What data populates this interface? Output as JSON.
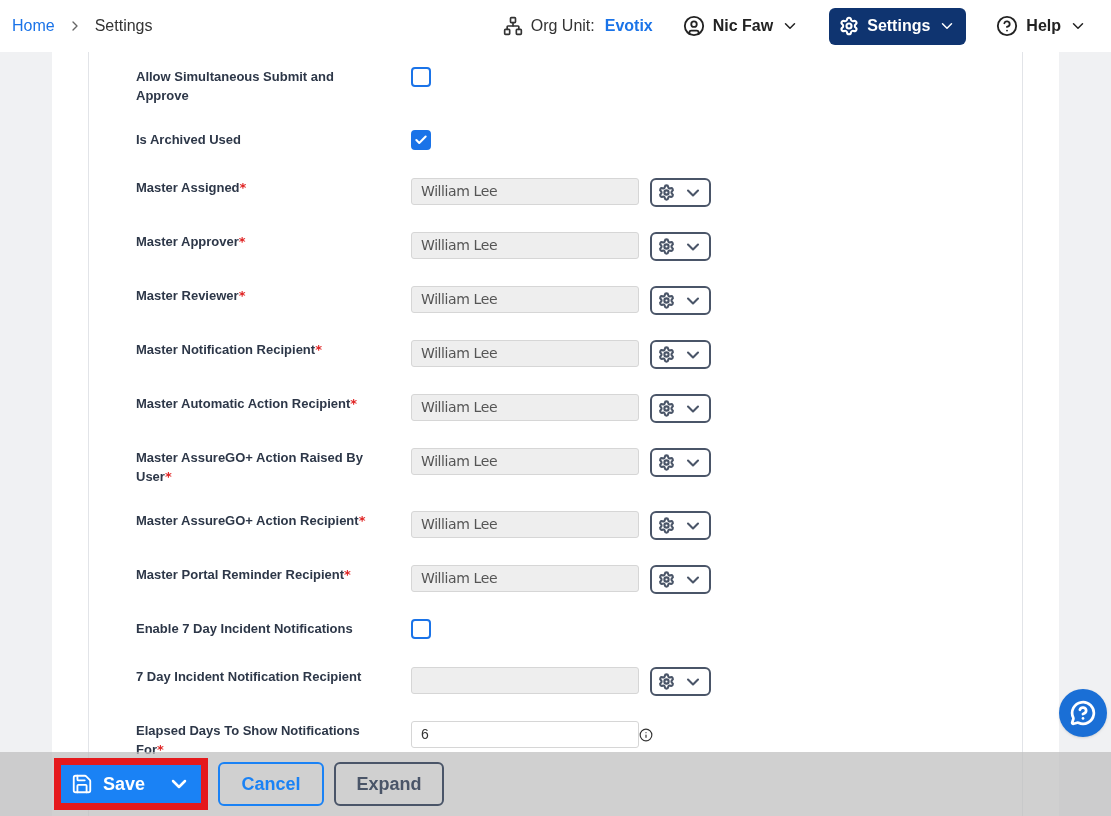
{
  "nav": {
    "breadcrumbs": [
      {
        "label": "Home",
        "link": true
      },
      {
        "label": "Settings",
        "link": false
      }
    ],
    "org_unit_label": "Org Unit:",
    "org_unit": "Evotix",
    "user": "Nic Faw",
    "settings": "Settings",
    "help": "Help"
  },
  "rows": [
    {
      "kind": "checkbox",
      "label": "Allow Simultaneous Submit and Approve",
      "checked": false
    },
    {
      "kind": "checkbox",
      "label": "Is Archived Used",
      "checked": true
    },
    {
      "kind": "picker",
      "label": "Master Assigned",
      "required_mark": "*",
      "value": "William Lee",
      "disabled": true
    },
    {
      "kind": "picker",
      "label": "Master Approver",
      "required_mark": "*",
      "value": "William Lee",
      "disabled": true
    },
    {
      "kind": "picker",
      "label": "Master Reviewer",
      "required_mark": "*",
      "value": "William Lee",
      "disabled": true
    },
    {
      "kind": "picker",
      "label": "Master Notification Recipient",
      "required_mark": "*",
      "value": "William Lee",
      "disabled": true
    },
    {
      "kind": "picker",
      "label": "Master Automatic Action Recipient",
      "required_mark": "*",
      "value": "William Lee",
      "disabled": true
    },
    {
      "kind": "picker",
      "label": "Master AssureGO+ Action Raised By User",
      "required_mark": "*",
      "value": "William Lee",
      "disabled": true
    },
    {
      "kind": "picker",
      "label": "Master AssureGO+ Action Recipient",
      "required_mark": "*",
      "value": "William Lee",
      "disabled": true
    },
    {
      "kind": "picker",
      "label": "Master Portal Reminder Recipient",
      "required_mark": "*",
      "value": "William Lee",
      "disabled": true
    },
    {
      "kind": "checkbox",
      "label": "Enable 7 Day Incident Notifications",
      "checked": false
    },
    {
      "kind": "picker",
      "label": "7 Day Incident Notification Recipient",
      "disabled": true
    },
    {
      "kind": "number",
      "label": "Elapsed Days To Show Notifications For",
      "required_mark": "*",
      "value": "6"
    }
  ],
  "footer": {
    "save": "Save",
    "cancel": "Cancel",
    "expand": "Expand"
  }
}
